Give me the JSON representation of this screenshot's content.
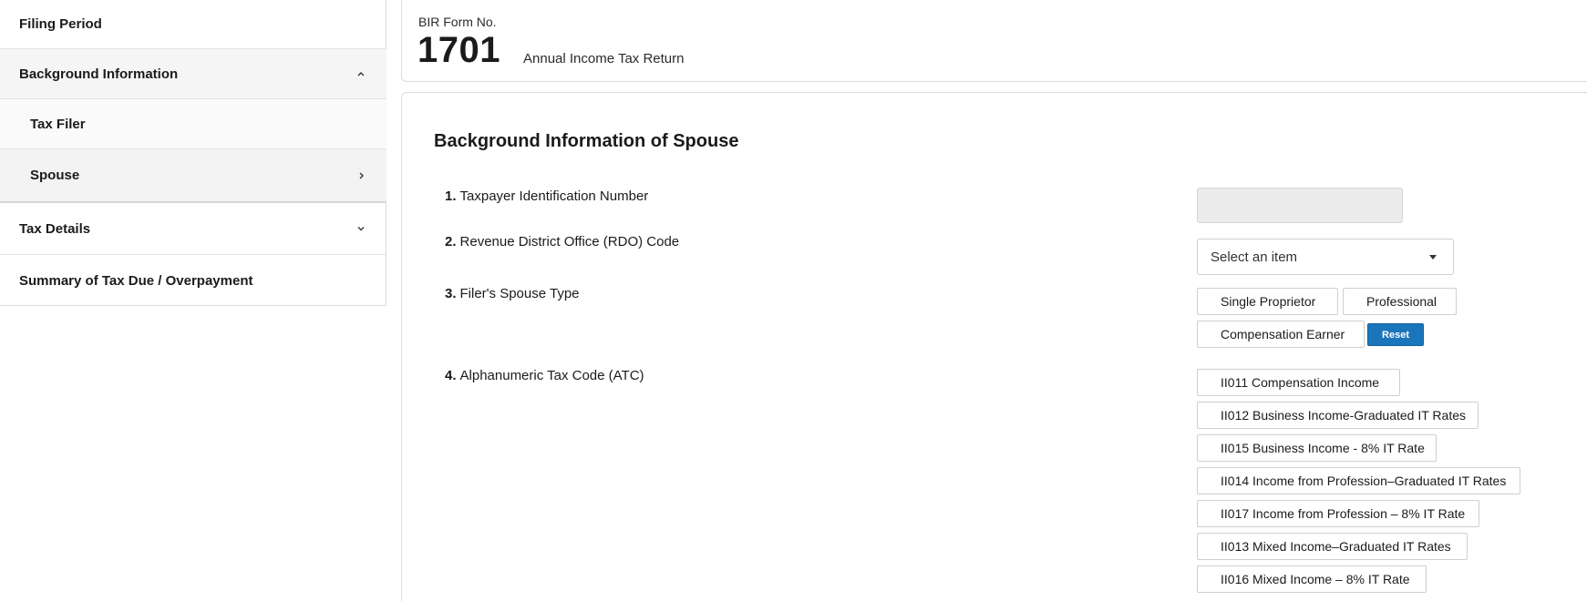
{
  "sidebar": {
    "items": [
      {
        "label": "Filing Period"
      },
      {
        "label": "Background Information"
      },
      {
        "label": "Tax Filer"
      },
      {
        "label": "Spouse"
      },
      {
        "label": "Tax Details"
      },
      {
        "label": "Summary of Tax Due / Overpayment"
      }
    ]
  },
  "header": {
    "form_no_label": "BIR Form No.",
    "form_no": "1701",
    "form_title": "Annual Income Tax Return"
  },
  "main": {
    "section_title": "Background Information of Spouse",
    "questions": [
      {
        "num": "1.",
        "label": "Taxpayer Identification Number"
      },
      {
        "num": "2.",
        "label": "Revenue District Office (RDO) Code"
      },
      {
        "num": "3.",
        "label": "Filer's Spouse Type"
      },
      {
        "num": "4.",
        "label": "Alphanumeric Tax Code (ATC)"
      }
    ],
    "tin_value": "",
    "rdo_select": {
      "selected": "Select an item"
    },
    "spouse_types": [
      "Single Proprietor",
      "Professional",
      "Compensation Earner"
    ],
    "reset_label": "Reset",
    "atc_options": [
      "II011 Compensation Income",
      "II012 Business Income-Graduated IT Rates",
      "II015 Business Income - 8% IT Rate",
      "II014 Income from Profession–Graduated IT Rates",
      "II017 Income from Profession – 8% IT Rate",
      "II013 Mixed Income–Graduated IT Rates",
      "II016 Mixed Income – 8% IT Rate"
    ]
  },
  "colors": {
    "accent": "#1b75bb",
    "border": "#dcdcdc",
    "input_disabled": "#ebebeb"
  },
  "icons": {
    "background_info": "chevron-up-icon",
    "spouse": "chevron-right-icon",
    "tax_details": "chevron-down-icon",
    "rdo_select": "caret-down-icon"
  }
}
